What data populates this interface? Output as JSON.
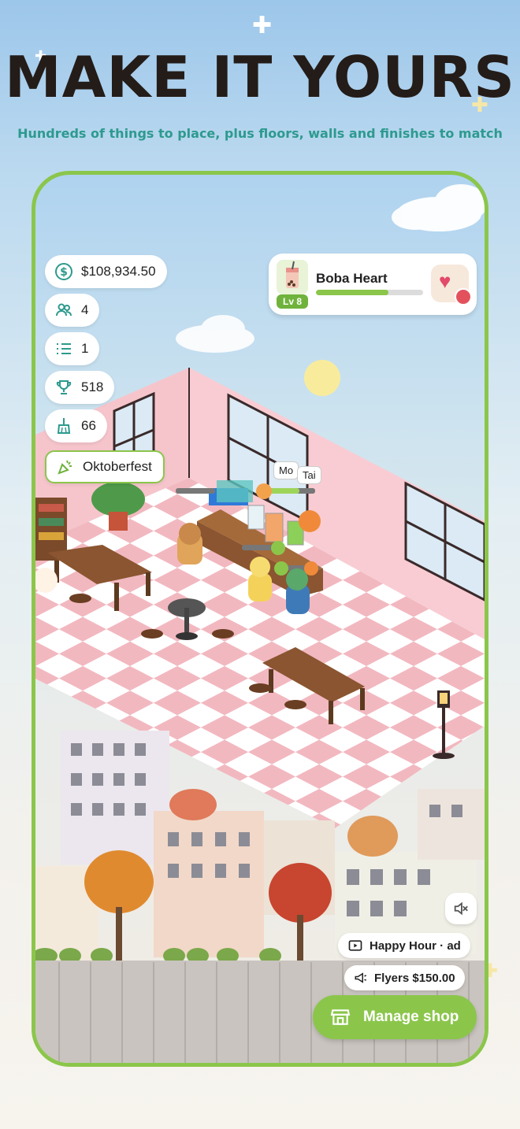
{
  "header": {
    "headline": "MAKE IT YOURS",
    "subline": "Hundreds of things to place, plus floors, walls and finishes to match"
  },
  "stats": {
    "money": "$108,934.50",
    "customers": "4",
    "queue": "1",
    "trophies": "518",
    "cleaning": "66",
    "event": "Oktoberfest"
  },
  "shop": {
    "name": "Boba Heart",
    "level": "Lv 8",
    "xp_progress": 0.68
  },
  "characters": {
    "tag1": "Mo",
    "tag2": "Tai"
  },
  "actions": {
    "happy_hour": "Happy Hour · ad",
    "flyers": "Flyers $150.00",
    "manage": "Manage shop"
  },
  "colors": {
    "accent_green": "#8bc64b",
    "teal_text": "#2d9a8e",
    "floor_pink": "#f2b8c0"
  }
}
